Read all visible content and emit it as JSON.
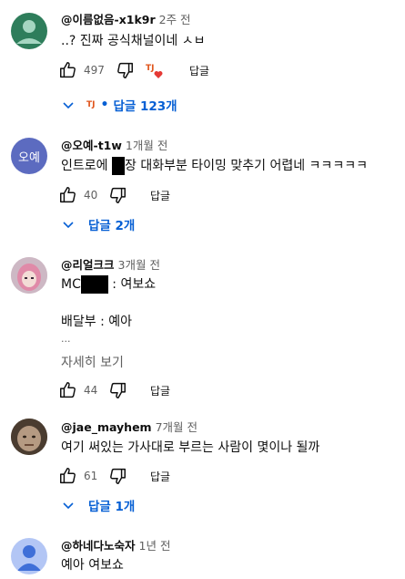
{
  "comments": [
    {
      "author": "@이름없음-x1k9r",
      "time": "2주 전",
      "text": "..? 진짜 공식채널이네 ㅅㅂ",
      "likes": "497",
      "reply_label": "답글",
      "replies_label": "답글 123개",
      "creator_badge": "TJ",
      "avatar_color": "#2e7d5b"
    },
    {
      "author": "@오예-t1w",
      "time": "1개월 전",
      "avatar_text": "오예",
      "text_before": "인트로에 ",
      "text_after": "장 대화부분 타이밍 맞추기 어렵네 ㅋㅋㅋㅋㅋ",
      "likes": "40",
      "reply_label": "답글",
      "replies_label": "답글 2개",
      "avatar_color": "#5c6bc0"
    },
    {
      "author": "@리얼크크",
      "time": "3개월 전",
      "line1_before": "MC",
      "line1_after": " : 여보쇼",
      "line2": "배달부 : 예아",
      "line3": "...",
      "more_label": "자세히 보기",
      "likes": "44",
      "reply_label": "답글"
    },
    {
      "author": "@jae_mayhem",
      "time": "7개월 전",
      "text": "여기 써있는 가사대로 부르는 사람이 몇이나 될까",
      "likes": "61",
      "reply_label": "답글",
      "replies_label": "답글 1개"
    },
    {
      "author": "@하네다노숙자",
      "time": "1년 전",
      "text": "예아 여보쇼"
    }
  ],
  "colors": {
    "link": "#065fd4",
    "muted": "#606060",
    "heart": "#e53935"
  }
}
